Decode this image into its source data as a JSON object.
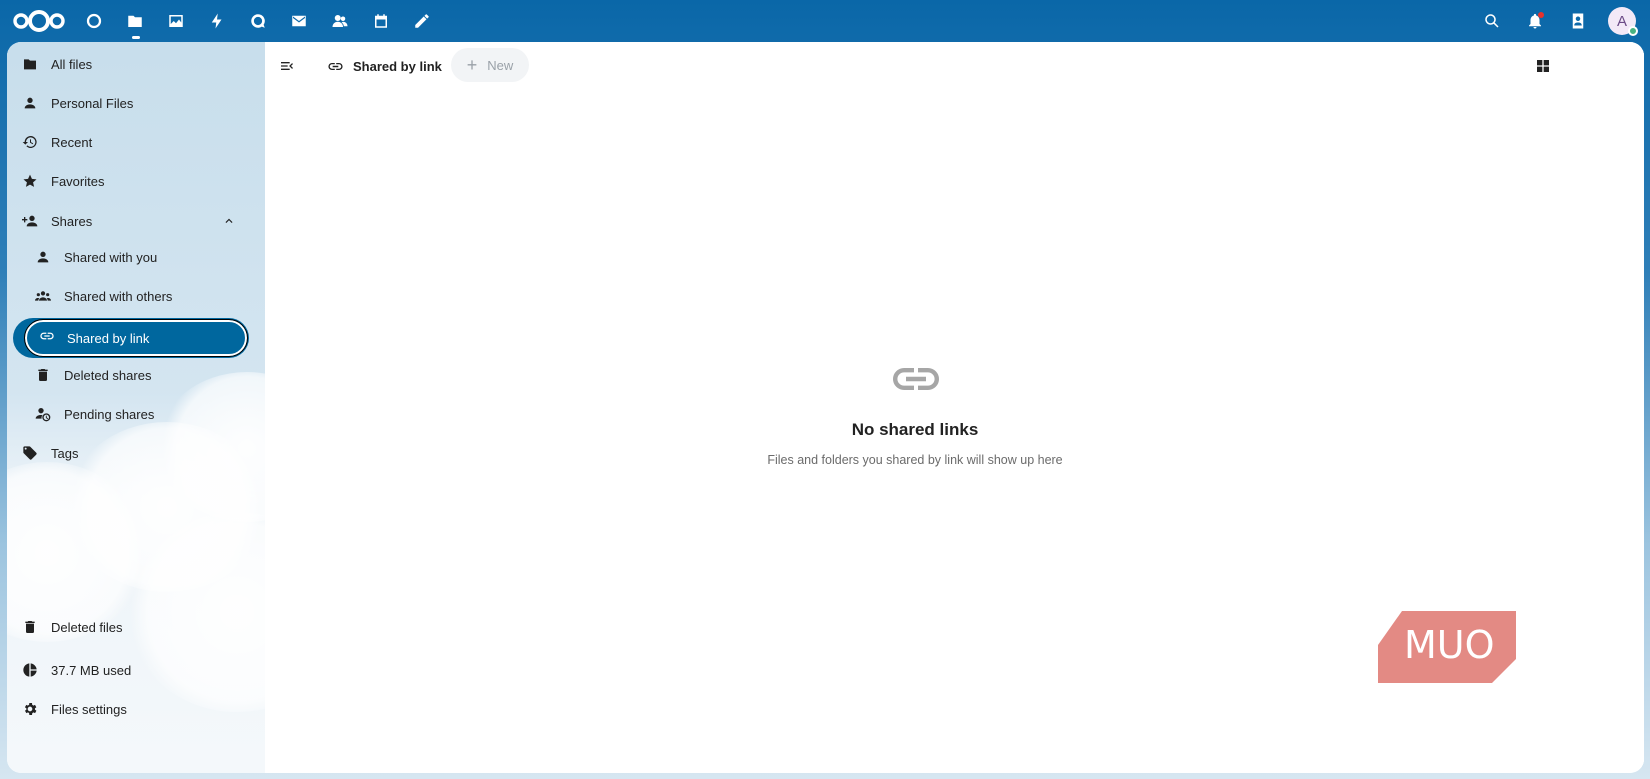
{
  "topbar": {
    "apps": [
      {
        "name": "dashboard-icon"
      },
      {
        "name": "files-icon",
        "active": true
      },
      {
        "name": "photos-icon"
      },
      {
        "name": "activity-icon"
      },
      {
        "name": "talk-icon"
      },
      {
        "name": "mail-icon"
      },
      {
        "name": "contacts-icon"
      },
      {
        "name": "calendar-icon"
      },
      {
        "name": "notes-icon"
      }
    ],
    "avatar_initial": "A"
  },
  "sidebar": {
    "all_files": "All files",
    "personal_files": "Personal Files",
    "recent": "Recent",
    "favorites": "Favorites",
    "shares": "Shares",
    "shared_with_you": "Shared with you",
    "shared_with_others": "Shared with others",
    "shared_by_link": "Shared by link",
    "deleted_shares": "Deleted shares",
    "pending_shares": "Pending shares",
    "tags": "Tags",
    "deleted_files": "Deleted files",
    "quota": "37.7 MB used",
    "files_settings": "Files settings"
  },
  "main": {
    "breadcrumb": "Shared by link",
    "new_button": "New",
    "empty_title": "No shared links",
    "empty_description": "Files and folders you shared by link will show up here"
  },
  "watermark": "MUO",
  "colors": {
    "primary": "#00679e",
    "watermark": "#e38a84"
  }
}
